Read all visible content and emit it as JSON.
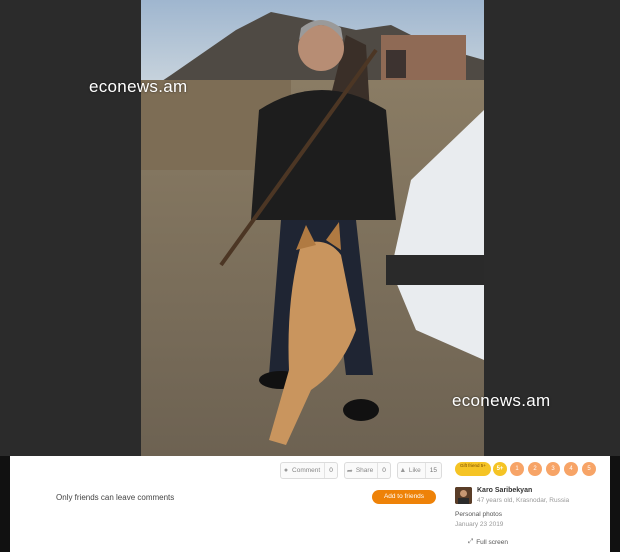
{
  "watermarks": [
    "econews.am",
    "econews.am"
  ],
  "actions": {
    "comment": {
      "label": "Comment",
      "count": "0"
    },
    "share": {
      "label": "Share",
      "count": "0"
    },
    "like": {
      "label": "Like",
      "count": "15"
    }
  },
  "comments_note": "Only friends can leave comments",
  "add_friends_label": "Add to friends",
  "gift_badge": "Gift friend 5+",
  "badge_5plus": "5+",
  "rating_options": [
    "1",
    "2",
    "3",
    "4",
    "5"
  ],
  "author": {
    "name": "Karo Saribekyan",
    "meta": "47 years old, Krasnodar, Russia"
  },
  "album": "Personal photos",
  "date": "January 23 2019",
  "fullscreen_label": "Full screen",
  "colors": {
    "accent": "#ee8208",
    "rating": "#f7a467",
    "badge": "#f5c425"
  },
  "icons": [
    "comment-icon",
    "share-icon",
    "like-icon",
    "fullscreen-icon"
  ]
}
